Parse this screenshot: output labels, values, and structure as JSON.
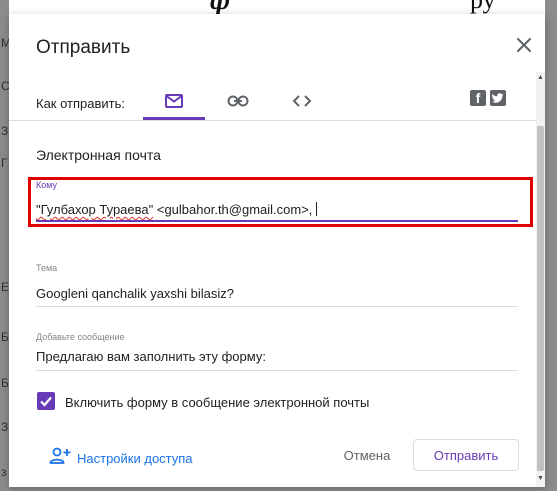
{
  "background": {
    "top_text_left": "ф",
    "top_text_right": "ру",
    "left_letters": [
      "М",
      "С",
      "З",
      "Г",
      "Е",
      "Б",
      "Б",
      "З",
      "з"
    ]
  },
  "dialog": {
    "title": "Отправить",
    "close_icon": "close-icon",
    "send_via_label": "Как отправить:",
    "methods": [
      {
        "icon": "email-icon",
        "selected": true
      },
      {
        "icon": "link-icon",
        "selected": false
      },
      {
        "icon": "embed-code-icon",
        "selected": false
      }
    ],
    "social": [
      {
        "icon": "facebook-icon",
        "glyph": "f"
      },
      {
        "icon": "twitter-icon",
        "glyph": "t"
      }
    ],
    "section_title": "Электронная почта",
    "to": {
      "label": "Кому",
      "name": "\"Гулбахор Тураева\"",
      "address": " <gulbahor.th@gmail.com>,"
    },
    "subject": {
      "label": "Тема",
      "value": "Googleni qanchalik yaxshi bilasiz?"
    },
    "message": {
      "label": "Добавьте сообщение",
      "value": "Предлагаю вам заполнить эту форму:"
    },
    "include_form": {
      "checked": true,
      "label": "Включить форму в сообщение электронной почты"
    },
    "access_settings_label": "Настройки доступа",
    "cancel_label": "Отмена",
    "send_label": "Отправить"
  },
  "colors": {
    "accent": "#673ab7",
    "link": "#1a73e8",
    "highlight": "#e00000"
  }
}
